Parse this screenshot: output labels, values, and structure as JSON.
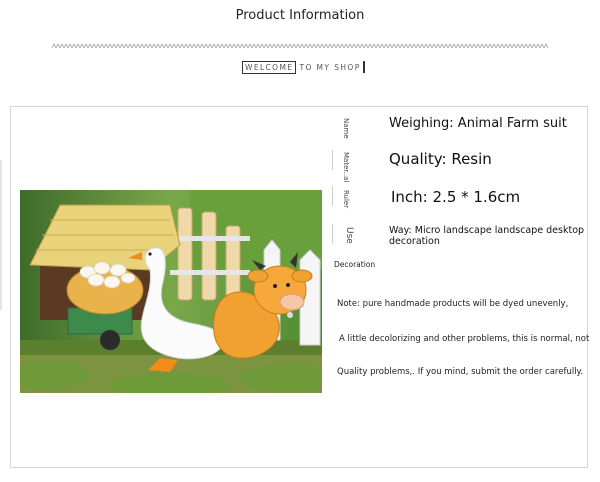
{
  "header": {
    "title": "Product Information"
  },
  "welcome": {
    "boxed": "WELCOME",
    "rest": "TO MY SHOP"
  },
  "side_labels": {
    "name": "Name",
    "material": "Mater..al",
    "ruler": "Ruler",
    "use": "Use",
    "decoration": "Decoration"
  },
  "specs": {
    "weighing": "Weighing: Animal Farm suit",
    "quality": "Quality: Resin",
    "inch": "Inch: 2.5 * 1.6cm",
    "way_line1": "Way: Micro landscape landscape desktop",
    "way_line2": "decoration"
  },
  "notes": {
    "line1": "Note: pure handmade products will be dyed unevenly,",
    "line2": "A little decolorizing and other problems, this is normal, not",
    "line3": "Quality problems,. If you mind, submit the order carefully."
  },
  "colors": {
    "zigzag": "#9a9a9a",
    "card_border": "#d6d6d6"
  }
}
